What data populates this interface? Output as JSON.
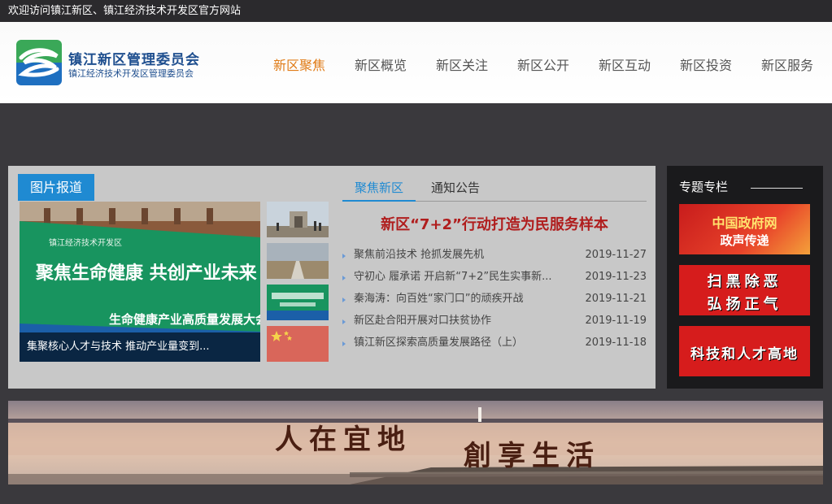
{
  "topbar": {
    "welcome": "欢迎访问镇江新区、镇江经济技术开发区官方网站"
  },
  "header": {
    "logo_title": "镇江新区管理委员会",
    "logo_subtitle": "镇江经济技术开发区管理委员会"
  },
  "nav": {
    "items": [
      "新区聚焦",
      "新区概览",
      "新区关注",
      "新区公开",
      "新区互动",
      "新区投资",
      "新区服务"
    ],
    "active_index": 0
  },
  "photo_report": {
    "label": "图片报道",
    "main_caption": "集聚核心人才与技术 推动产业量变到...",
    "main_sign_line1": "聚焦生命健康 共创产业未来",
    "main_sign_line2": "生命健康产业高质量发展大会",
    "main_sign_org": "镇江经济技术开发区"
  },
  "tabs": {
    "active": "聚焦新区",
    "inactive": "通知公告"
  },
  "headline": "新区“7+2”行动打造为民服务样本",
  "news": [
    {
      "title": "聚焦前沿技术 抢抓发展先机",
      "date": "2019-11-27"
    },
    {
      "title": "守初心 履承诺 开启新“7+2”民生实事新...",
      "date": "2019-11-23"
    },
    {
      "title": "秦海涛：向百姓“家门口”的顽疾开战",
      "date": "2019-11-21"
    },
    {
      "title": "新区赴合阳开展对口扶贫协作",
      "date": "2019-11-19"
    },
    {
      "title": "镇江新区探索高质量发展路径（上）",
      "date": "2019-11-18"
    }
  ],
  "special": {
    "title": "专题专栏",
    "banners": [
      {
        "line1": "中国政府网",
        "line2": "政声传递"
      },
      {
        "line1": "扫黑除恶",
        "line2": "弘扬正气"
      },
      {
        "line1": "科技和人才高地",
        "line2": ""
      }
    ]
  },
  "banner": {
    "text1": "人在宜地",
    "text2": "創享生活"
  },
  "colors": {
    "accent": "#1f8ad2",
    "nav_active": "#e07b16",
    "headline": "#b01d1d"
  }
}
